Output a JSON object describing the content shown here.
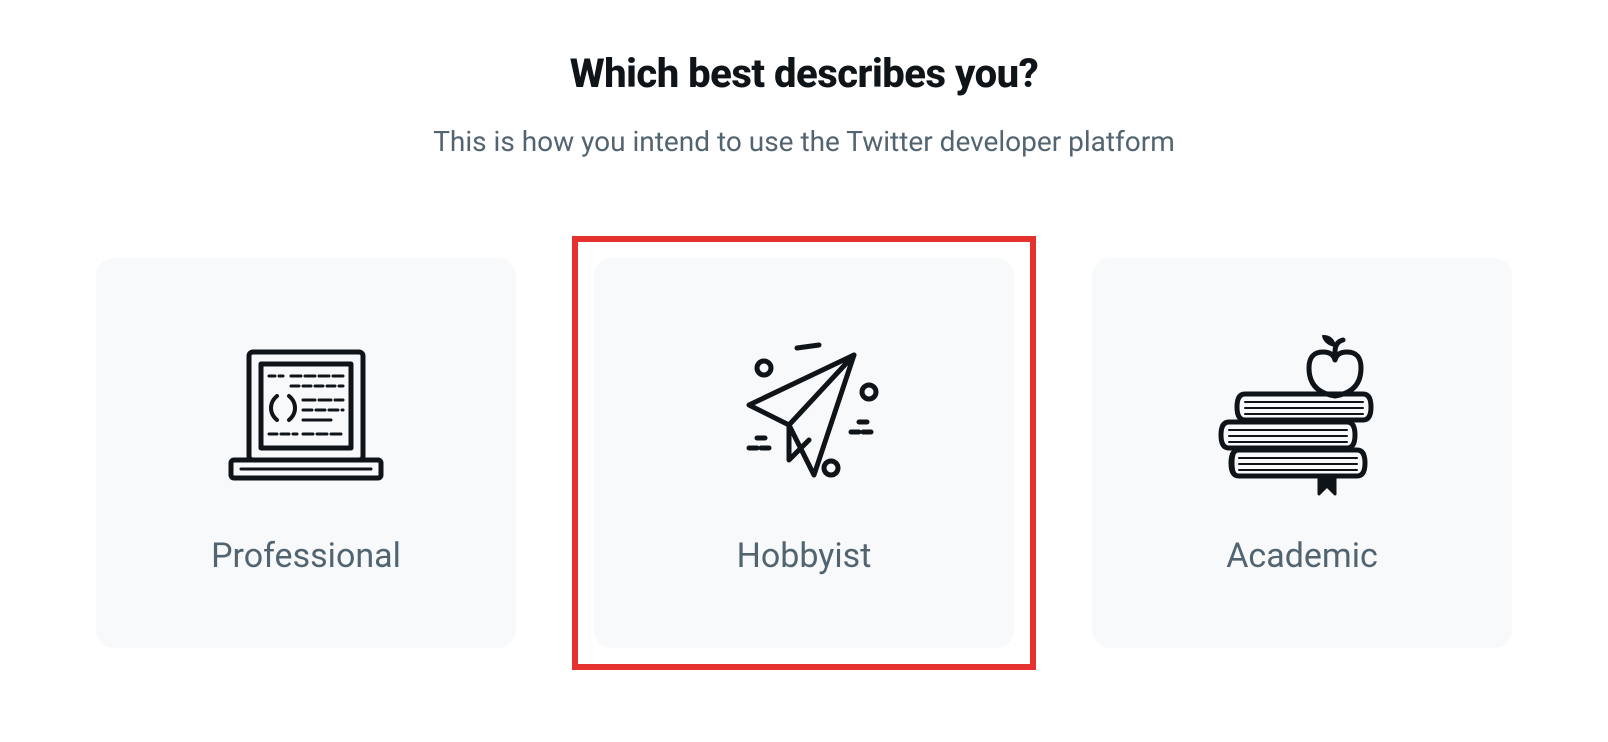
{
  "heading": "Which best describes you?",
  "subheading": "This is how you intend to use the Twitter developer platform",
  "options": [
    {
      "label": "Professional",
      "icon": "laptop-code-icon",
      "highlighted": false
    },
    {
      "label": "Hobbyist",
      "icon": "paper-plane-icon",
      "highlighted": true
    },
    {
      "label": "Academic",
      "icon": "books-apple-icon",
      "highlighted": false
    }
  ],
  "colors": {
    "highlight_border": "#e6322f",
    "card_bg": "#f7f9fa",
    "text_main": "#0f1419",
    "text_muted": "#536471"
  }
}
